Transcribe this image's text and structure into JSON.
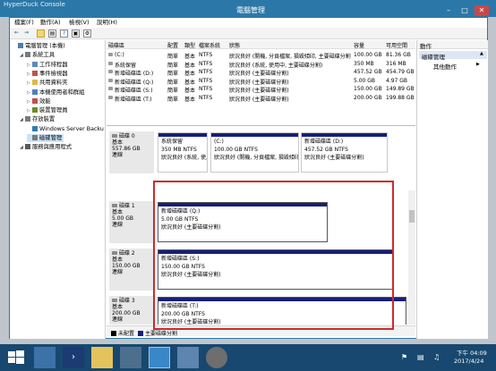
{
  "console_title": "HyperDuck Console",
  "app_title": "電腦管理",
  "window_buttons": [
    "minimize-icon",
    "maximize-icon",
    "close-icon"
  ],
  "menu": [
    "檔案(F)",
    "動作(A)",
    "檢視(V)",
    "說明(H)"
  ],
  "toolbar_icons": [
    "back-icon",
    "forward-icon",
    "up-folder-icon",
    "properties-icon",
    "help-icon",
    "refresh-icon",
    "settings-icon"
  ],
  "tree": [
    {
      "label": "電腦管理 (本機)",
      "level": 0,
      "icon": "computer-icon"
    },
    {
      "label": "系統工具",
      "level": 1,
      "icon": "tools-icon"
    },
    {
      "label": "工作排程器",
      "level": 2,
      "icon": "scheduler-icon"
    },
    {
      "label": "事件檢視器",
      "level": 2,
      "icon": "event-icon"
    },
    {
      "label": "共用資料夾",
      "level": 2,
      "icon": "folder-icon"
    },
    {
      "label": "本機使用者和群組",
      "level": 2,
      "icon": "users-icon"
    },
    {
      "label": "效能",
      "level": 2,
      "icon": "performance-icon"
    },
    {
      "label": "裝置管理員",
      "level": 2,
      "icon": "device-icon"
    },
    {
      "label": "存放裝置",
      "level": 1,
      "icon": "storage-icon"
    },
    {
      "label": "Windows Server Backu",
      "level": 2,
      "icon": "backup-icon"
    },
    {
      "label": "磁碟管理",
      "level": 2,
      "icon": "disk-icon",
      "selected": true
    },
    {
      "label": "服務與應用程式",
      "level": 1,
      "icon": "services-icon"
    }
  ],
  "volume_table": {
    "headers": [
      "磁碟區",
      "配置",
      "類型",
      "檔案系統",
      "狀態",
      "容量",
      "可用空間"
    ],
    "rows": [
      [
        "(C:)",
        "簡單",
        "基本",
        "NTFS",
        "狀況良好 (開機, 分頁檔案, 損毀傾印, 主要磁碟分割)",
        "100.00 GB",
        "81.36 GB"
      ],
      [
        "系統保留",
        "簡單",
        "基本",
        "NTFS",
        "狀況良好 (系統, 使用中, 主要磁碟分割)",
        "350 MB",
        "316 MB"
      ],
      [
        "新增磁碟區 (D:)",
        "簡單",
        "基本",
        "NTFS",
        "狀況良好 (主要磁碟分割)",
        "457.52 GB",
        "454.79 GB"
      ],
      [
        "新增磁碟區 (Q:)",
        "簡單",
        "基本",
        "NTFS",
        "狀況良好 (主要磁碟分割)",
        "5.00 GB",
        "4.97 GB"
      ],
      [
        "新增磁碟區 (S:)",
        "簡單",
        "基本",
        "NTFS",
        "狀況良好 (主要磁碟分割)",
        "150.00 GB",
        "149.89 GB"
      ],
      [
        "新增磁碟區 (T:)",
        "簡單",
        "基本",
        "NTFS",
        "狀況良好 (主要磁碟分割)",
        "200.00 GB",
        "199.88 GB"
      ]
    ]
  },
  "disks": [
    {
      "name": "磁碟 0",
      "type": "基本",
      "size": "557.86 GB",
      "status": "連線",
      "partitions": [
        {
          "name": "系統保留",
          "size": "350 MB NTFS",
          "status": "狀況良好 (系統, 使用"
        },
        {
          "name": "(C:)",
          "size": "100.00 GB NTFS",
          "status": "狀況良好 (開機, 分頁檔案, 損毀傾印, 主"
        },
        {
          "name": "新增磁碟區 (D:)",
          "size": "457.52 GB NTFS",
          "status": "狀況良好 (主要磁碟分割)"
        }
      ]
    },
    {
      "name": "磁碟 1",
      "type": "基本",
      "size": "5.00 GB",
      "status": "連線",
      "partitions": [
        {
          "name": "新增磁碟區 (Q:)",
          "size": "5.00 GB NTFS",
          "status": "狀況良好 (主要磁碟分割)"
        }
      ]
    },
    {
      "name": "磁碟 2",
      "type": "基本",
      "size": "150.00 GB",
      "status": "連線",
      "partitions": [
        {
          "name": "新增磁碟區 (S:)",
          "size": "150.00 GB NTFS",
          "status": "狀況良好 (主要磁碟分割)"
        }
      ]
    },
    {
      "name": "磁碟 3",
      "type": "基本",
      "size": "200.00 GB",
      "status": "連線",
      "partitions": [
        {
          "name": "新增磁碟區 (T:)",
          "size": "200.00 GB NTFS",
          "status": "狀況良好 (主要磁碟分割)"
        }
      ]
    }
  ],
  "legend": [
    {
      "label": "未配置",
      "color": "#000000"
    },
    {
      "label": "主要磁碟分割",
      "color": "#151f7a"
    }
  ],
  "actions": {
    "header": "動作",
    "section": "磁碟管理",
    "item": "其他動作"
  },
  "clock": {
    "time": "下午 04:09",
    "date": "2017/4/24"
  },
  "taskbar_icons": [
    "start-icon",
    "server-manager-icon",
    "powershell-icon",
    "file-explorer-icon",
    "network-icon",
    "computer-management-icon",
    "remote-desktop-icon",
    "settings-icon"
  ],
  "colors": {
    "accent": "#2b78a8",
    "partition_bar": "#151f7a",
    "highlight": "#cd2b2b",
    "taskbar": "#18486f"
  }
}
